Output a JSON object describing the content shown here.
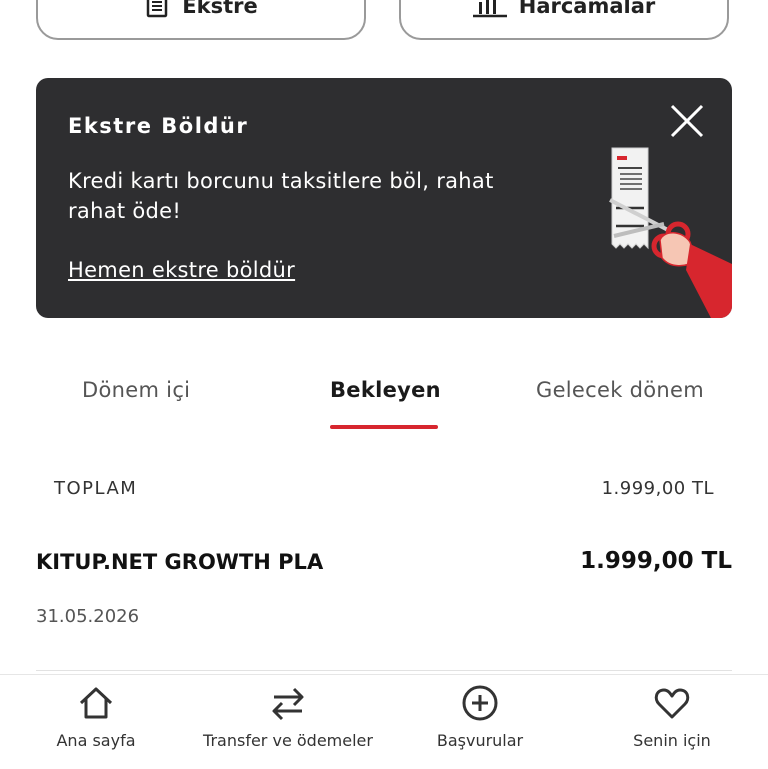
{
  "top_buttons": {
    "ekstre_label": "Ekstre",
    "harcamalar_label": "Harcamalar"
  },
  "banner": {
    "title": "Ekstre Böldür",
    "text": "Kredi kartı borcunu taksitlere böl, rahat rahat öde!",
    "link": "Hemen ekstre böldür",
    "background_color": "#2e2e30"
  },
  "tabs": [
    {
      "label": "Dönem içi",
      "active": false
    },
    {
      "label": "Bekleyen",
      "active": true
    },
    {
      "label": "Gelecek dönem",
      "active": false
    }
  ],
  "accent_color": "#d7262e",
  "summary": {
    "label": "TOPLAM",
    "amount": "1.999,00 TL"
  },
  "transactions": [
    {
      "name": "KITUP.NET GROWTH PLA",
      "amount": "1.999,00 TL",
      "date": "31.05.2026"
    }
  ],
  "bottom_nav": [
    {
      "label": "Ana sayfa",
      "icon": "home-icon"
    },
    {
      "label": "Transfer ve ödemeler",
      "icon": "transfer-arrows-icon"
    },
    {
      "label": "Başvurular",
      "icon": "plus-circle-icon"
    },
    {
      "label": "Senin için",
      "icon": "heart-icon"
    }
  ]
}
